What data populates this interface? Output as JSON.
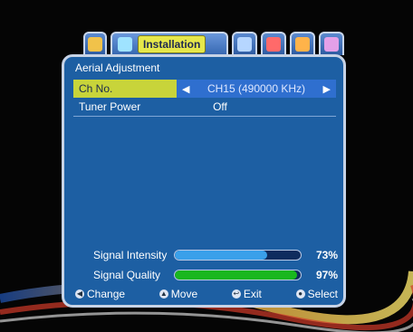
{
  "tabs": [
    {
      "icon": "tv-icon",
      "active": false
    },
    {
      "icon": "satellite-dish-icon",
      "active": true,
      "label": "Installation"
    },
    {
      "icon": "settings-icon",
      "active": false
    },
    {
      "icon": "heart-icon",
      "active": false
    },
    {
      "icon": "sun-icon",
      "active": false
    },
    {
      "icon": "gear-icon",
      "active": false
    }
  ],
  "panel": {
    "title": "Aerial Adjustment",
    "rows": [
      {
        "label": "Ch No.",
        "value": "CH15 (490000 KHz)",
        "selected": true
      },
      {
        "label": "Tuner Power",
        "value": "Off",
        "selected": false
      }
    ]
  },
  "signal": {
    "intensity_label": "Signal Intensity",
    "intensity_value": "73%",
    "intensity_level": 0.73,
    "quality_label": "Signal Quality",
    "quality_value": "97%",
    "quality_level": 0.97
  },
  "footer": {
    "change": "Change",
    "move": "Move",
    "exit": "Exit",
    "select": "Select"
  },
  "colors": {
    "panel": "#1d5fa3",
    "selected_row": "#c8d43a",
    "intensity_bar": "#3aa0ea",
    "quality_bar": "#19b71e"
  }
}
